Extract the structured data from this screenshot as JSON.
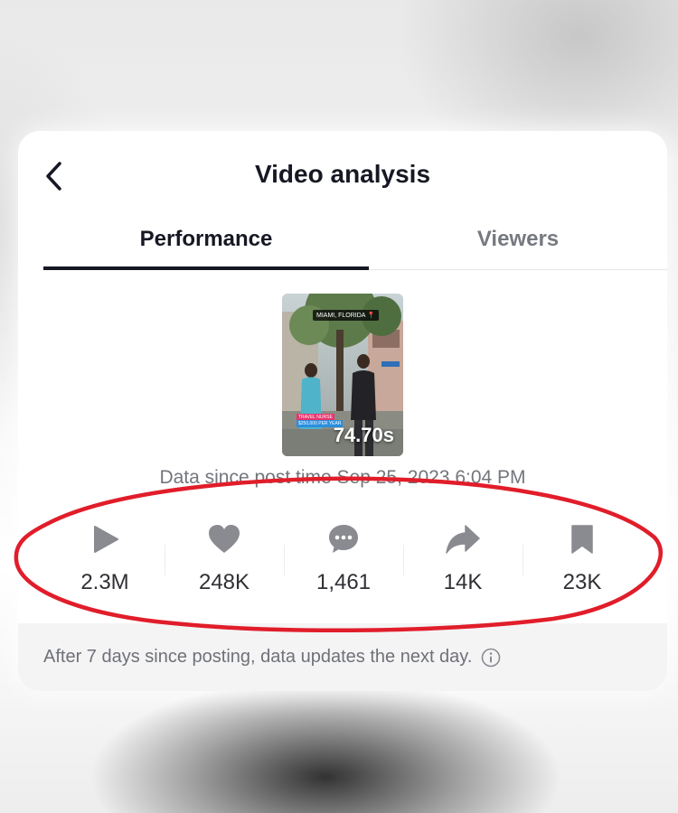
{
  "header": {
    "title": "Video analysis",
    "back_icon": "chevron-left-icon"
  },
  "tabs": [
    {
      "label": "Performance",
      "active": true
    },
    {
      "label": "Viewers",
      "active": false
    }
  ],
  "video": {
    "location_tag": "MIAMI, FLORIDA 📍",
    "caption_line1": "TRAVEL NURSE",
    "caption_line2": "$250,000 PER YEAR",
    "duration": "74.70s"
  },
  "data_since": "Data since post time Sep 25, 2023 6:04 PM",
  "stats": [
    {
      "icon": "play-icon",
      "value": "2.3M"
    },
    {
      "icon": "heart-icon",
      "value": "248K"
    },
    {
      "icon": "comment-icon",
      "value": "1,461"
    },
    {
      "icon": "share-icon",
      "value": "14K"
    },
    {
      "icon": "bookmark-icon",
      "value": "23K"
    }
  ],
  "footer": {
    "note": "After 7 days since posting, data updates the next day.",
    "info_icon": "info-icon"
  },
  "colors": {
    "icon_gray": "#8a8b91",
    "highlight_red": "#e11d2a",
    "text_dark": "#161823"
  }
}
